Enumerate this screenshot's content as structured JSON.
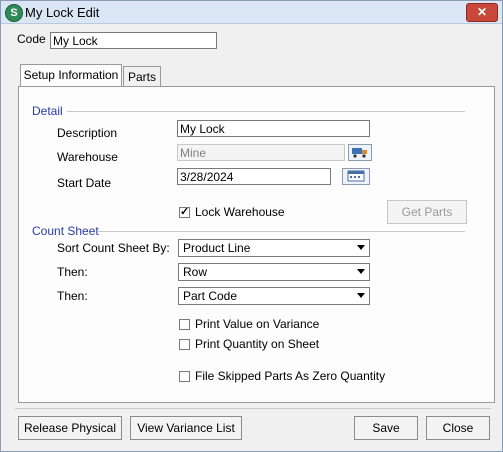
{
  "window": {
    "title": "My Lock Edit",
    "app_icon_letter": "S",
    "close_glyph": "✕"
  },
  "code": {
    "label": "Code",
    "value": "My Lock"
  },
  "tabs": [
    {
      "label": "Setup Information",
      "active": true
    },
    {
      "label": "Parts",
      "active": false
    }
  ],
  "detail": {
    "section_title": "Detail",
    "description": {
      "label": "Description",
      "value": "My Lock"
    },
    "warehouse": {
      "label": "Warehouse",
      "value": "Mine"
    },
    "start_date": {
      "label": "Start Date",
      "value": "3/28/2024"
    },
    "lock_warehouse": {
      "label": "Lock Warehouse",
      "checked": true
    },
    "get_parts_label": "Get Parts"
  },
  "count_sheet": {
    "section_title": "Count Sheet",
    "sort_label": "Sort Count Sheet By:",
    "sort_value": "Product Line",
    "then1_label": "Then:",
    "then1_value": "Row",
    "then2_label": "Then:",
    "then2_value": "Part Code",
    "print_value_on_variance": {
      "label": "Print Value on Variance",
      "checked": false
    },
    "print_quantity_on_sheet": {
      "label": "Print Quantity on Sheet",
      "checked": false
    },
    "file_skipped_parts": {
      "label": "File Skipped Parts As Zero Quantity",
      "checked": false
    }
  },
  "footer": {
    "release_physical": "Release Physical",
    "view_variance_list": "View Variance List",
    "save": "Save",
    "close": "Close"
  },
  "colors": {
    "section_title": "#2a3aa8",
    "window_border": "#8a9bb4",
    "close_button": "#c9483b"
  }
}
